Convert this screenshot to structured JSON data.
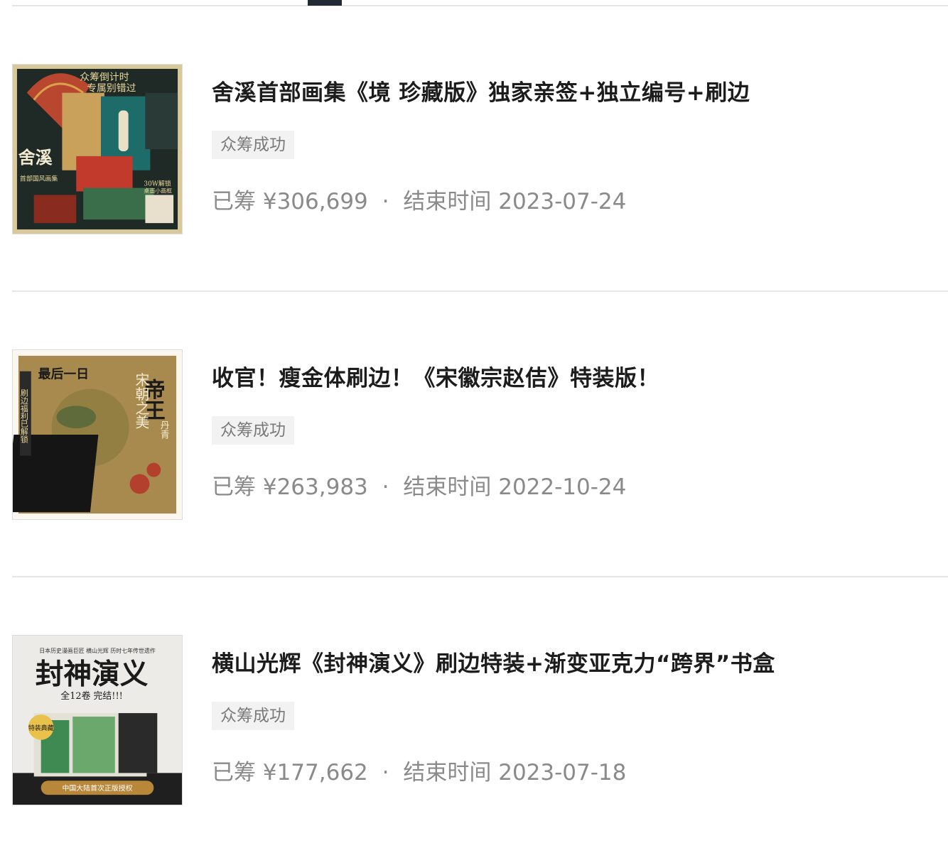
{
  "projects": [
    {
      "title": "舍溪首部画集《境 珍藏版》独家亲签+独立编号+刷边",
      "status": "众筹成功",
      "raised_label": "已筹",
      "raised_amount": "¥306,699",
      "separator": "·",
      "end_label": "结束时间",
      "end_date": "2023-07-24",
      "cover": {
        "heading": "众筹倒计时",
        "subheading": "专属别错过",
        "side_text": "舍溪",
        "side_sub": "首部国风画集",
        "corner_text": "30W解锁",
        "corner_sub": "桌面小画框"
      }
    },
    {
      "title": "收官！瘦金体刷边！《宋徽宗赵佶》特装版！",
      "status": "众筹成功",
      "raised_label": "已筹",
      "raised_amount": "¥263,983",
      "separator": "·",
      "end_label": "结束时间",
      "end_date": "2022-10-24",
      "cover": {
        "heading": "最后一日",
        "side_left": "刷边福利已解锁",
        "right_big": "帝王",
        "right_mid": "宋朝之美",
        "right_small": "丹青"
      }
    },
    {
      "title": "横山光辉《封神演义》刷边特装+渐变亚克力“跨界”书盒",
      "status": "众筹成功",
      "raised_label": "已筹",
      "raised_amount": "¥177,662",
      "separator": "·",
      "end_label": "结束时间",
      "end_date": "2023-07-18",
      "cover": {
        "topline": "日本历史漫画巨匠 横山光辉 历时七年传世遗作",
        "heading": "封神演义",
        "sub": "全12卷 完结!!!",
        "badge": "特装典藏",
        "footer": "中国大陆首次正版授权"
      }
    }
  ],
  "colors": {
    "tab_indicator": "#222a35",
    "divider": "#e6e6e6",
    "badge_bg": "#f2f2f2",
    "meta_text": "#8a8a8a"
  }
}
